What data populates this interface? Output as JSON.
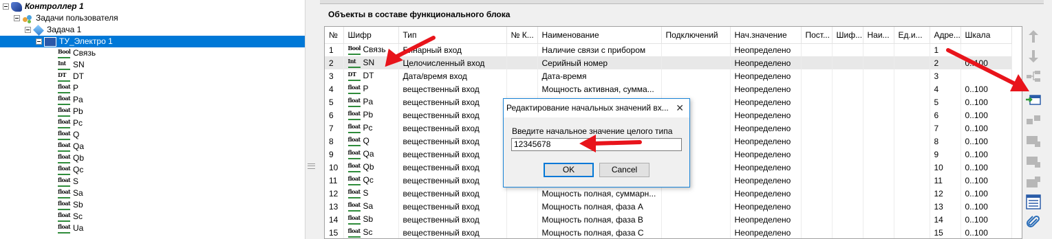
{
  "tree": {
    "items": [
      {
        "label": "Контроллер 1",
        "kind": "controller"
      },
      {
        "label": "Задачи пользователя",
        "kind": "tasks"
      },
      {
        "label": "Задача 1",
        "kind": "task"
      },
      {
        "label": "ТУ_Электро 1",
        "kind": "block"
      },
      {
        "label": "Связь",
        "type": "Bool"
      },
      {
        "label": "SN",
        "type": "Int"
      },
      {
        "label": "DT",
        "type": "DT"
      },
      {
        "label": "P",
        "type": "float"
      },
      {
        "label": "Pa",
        "type": "float"
      },
      {
        "label": "Pb",
        "type": "float"
      },
      {
        "label": "Pc",
        "type": "float"
      },
      {
        "label": "Q",
        "type": "float"
      },
      {
        "label": "Qa",
        "type": "float"
      },
      {
        "label": "Qb",
        "type": "float"
      },
      {
        "label": "Qc",
        "type": "float"
      },
      {
        "label": "S",
        "type": "float"
      },
      {
        "label": "Sa",
        "type": "float"
      },
      {
        "label": "Sb",
        "type": "float"
      },
      {
        "label": "Sc",
        "type": "float"
      },
      {
        "label": "Ua",
        "type": "float"
      }
    ]
  },
  "panel": {
    "title": "Объекты в составе функционального блока"
  },
  "grid": {
    "columns": [
      "№",
      "Шифр",
      "Тип",
      "№ К...",
      "Наименование",
      "Подключений",
      "Нач.значение",
      "Пост...",
      "Шиф...",
      "Наи...",
      "Ед.и...",
      "Адре...",
      "Шкала"
    ],
    "rows": [
      [
        "1",
        "Bool",
        "Связь",
        "Бинарный вход",
        "",
        "Наличие связи с прибором",
        "",
        "Неопределено",
        "",
        "",
        "",
        "",
        "1",
        ""
      ],
      [
        "2",
        "Int",
        "SN",
        "Целочисленный вход",
        "",
        "Серийный номер",
        "",
        "Неопределено",
        "",
        "",
        "",
        "",
        "2",
        "0..100"
      ],
      [
        "3",
        "DT",
        "DT",
        "Дата/время вход",
        "",
        "Дата-время",
        "",
        "Неопределено",
        "",
        "",
        "",
        "",
        "3",
        ""
      ],
      [
        "4",
        "float",
        "P",
        "вещественный вход",
        "",
        "Мощность активная, сумма...",
        "",
        "Неопределено",
        "",
        "",
        "",
        "",
        "4",
        "0..100"
      ],
      [
        "5",
        "float",
        "Pa",
        "вещественный вход",
        "",
        "",
        "",
        "Неопределено",
        "",
        "",
        "",
        "",
        "5",
        "0..100"
      ],
      [
        "6",
        "float",
        "Pb",
        "вещественный вход",
        "",
        "",
        "",
        "Неопределено",
        "",
        "",
        "",
        "",
        "6",
        "0..100"
      ],
      [
        "7",
        "float",
        "Pc",
        "вещественный вход",
        "",
        "",
        "",
        "Неопределено",
        "",
        "",
        "",
        "",
        "7",
        "0..100"
      ],
      [
        "8",
        "float",
        "Q",
        "вещественный вход",
        "",
        "",
        "",
        "Неопределено",
        "",
        "",
        "",
        "",
        "8",
        "0..100"
      ],
      [
        "9",
        "float",
        "Qa",
        "вещественный вход",
        "",
        "",
        "",
        "Неопределено",
        "",
        "",
        "",
        "",
        "9",
        "0..100"
      ],
      [
        "10",
        "float",
        "Qb",
        "вещественный вход",
        "",
        "",
        "",
        "Неопределено",
        "",
        "",
        "",
        "",
        "10",
        "0..100"
      ],
      [
        "11",
        "float",
        "Qc",
        "вещественный вход",
        "",
        "",
        "",
        "Неопределено",
        "",
        "",
        "",
        "",
        "11",
        "0..100"
      ],
      [
        "12",
        "float",
        "S",
        "вещественный вход",
        "",
        "Мощность полная, суммарн...",
        "",
        "Неопределено",
        "",
        "",
        "",
        "",
        "12",
        "0..100"
      ],
      [
        "13",
        "float",
        "Sa",
        "вещественный вход",
        "",
        "Мощность полная, фаза А",
        "",
        "Неопределено",
        "",
        "",
        "",
        "",
        "13",
        "0..100"
      ],
      [
        "14",
        "float",
        "Sb",
        "вещественный вход",
        "",
        "Мощность полная, фаза В",
        "",
        "Неопределено",
        "",
        "",
        "",
        "",
        "14",
        "0..100"
      ],
      [
        "15",
        "float",
        "Sc",
        "вещественный вход",
        "",
        "Мощность полная, фаза С",
        "",
        "Неопределено",
        "",
        "",
        "",
        "",
        "15",
        "0..100"
      ]
    ],
    "selected_row": 2
  },
  "toolbar": {
    "buttons": [
      "arrow-up-icon",
      "arrow-down-icon",
      "tree-link-icon",
      "import-initial-values-icon",
      "link-icon",
      "block-icon",
      "block-icon",
      "block-icon",
      "list-icon",
      "paperclip-icon"
    ]
  },
  "dialog": {
    "title": "Редактирование начальных значений вх...",
    "close": "✕",
    "prompt": "Введите начальное значение целого типа",
    "value": "12345678",
    "ok_label": "OK",
    "cancel_label": "Cancel"
  },
  "colors": {
    "selection": "#0078d7",
    "annotation_arrow": "#e8141b",
    "dialog_border": "#1883d7"
  }
}
